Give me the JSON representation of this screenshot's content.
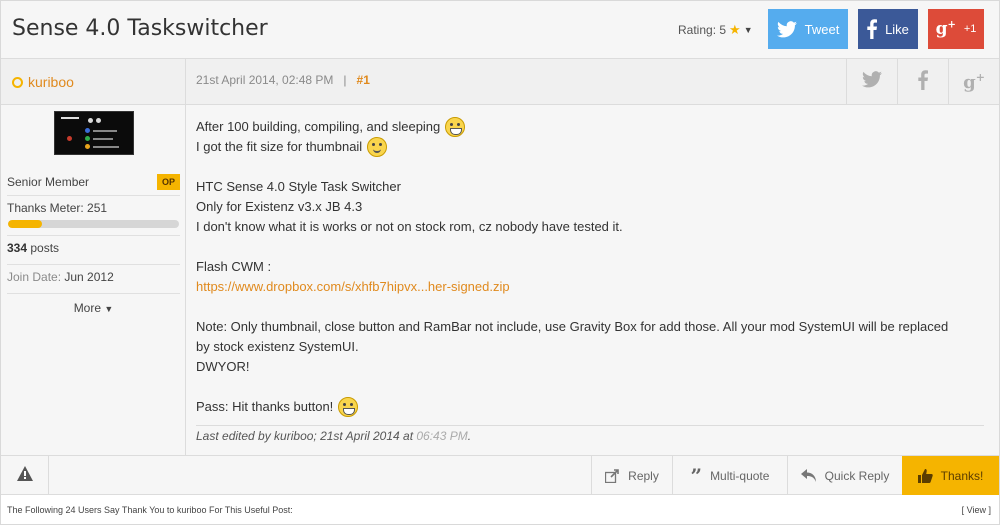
{
  "thread": {
    "title": "Sense 4.0 Taskswitcher",
    "rating_label": "Rating: 5",
    "tweet_label": "Tweet",
    "like_label": "Like",
    "gplus_label": "+1"
  },
  "post": {
    "username": "kuriboo",
    "date": "21st April 2014, 02:48 PM",
    "separator": "|",
    "number": "#1",
    "lines": [
      "After 100 building, compiling, and sleeping",
      "I got the fit size for thumbnail",
      "",
      "HTC Sense 4.0 Style Task Switcher",
      "Only for Existenz v3.x JB 4.3",
      "I don't know what it is works or not on stock rom, cz nobody have tested it.",
      "",
      "Flash CWM :",
      "https://www.dropbox.com/s/xhfb7hipvx...her-signed.zip",
      "",
      "Note: Only thumbnail, close button and RamBar not include, use Gravity Box for add those. All your mod SystemUI will be replaced",
      "by stock existenz SystemUI.",
      "DWYOR!",
      "",
      "Pass: Hit thanks button!"
    ],
    "edit_prefix": "Last edited by kuriboo; 21st April 2014 at",
    "edit_time": "06:43 PM",
    "edit_suffix": "."
  },
  "user": {
    "rank": "Senior Member",
    "badge": "OP",
    "thanks_meter_label": "Thanks Meter: 251",
    "thanks_meter_fraction": 0.2,
    "posts_count": "334",
    "posts_label": "posts",
    "join_label": "Join Date:",
    "join_value": "Jun 2012",
    "more_label": "More"
  },
  "actions": {
    "reply": "Reply",
    "multi_quote": "Multi-quote",
    "quick_reply": "Quick Reply",
    "thanks": "Thanks!"
  },
  "thanks_footer": {
    "text": "The Following 24 Users Say Thank You to kuriboo For This Useful Post:",
    "view": "[ View ]"
  },
  "icons": {
    "share_twitter": "twitter-icon",
    "share_facebook": "facebook-icon",
    "share_gplus": "google-plus-icon",
    "report": "warning-icon",
    "reply": "reply-arrow-icon",
    "multi_quote": "quote-icon",
    "quick_reply": "back-arrow-icon",
    "thanks": "thumbs-up-icon"
  },
  "colors": {
    "accent": "#f5b400",
    "link": "#e08a1e",
    "twitter": "#55acee",
    "facebook": "#3b5998",
    "gplus": "#dd4b39"
  }
}
